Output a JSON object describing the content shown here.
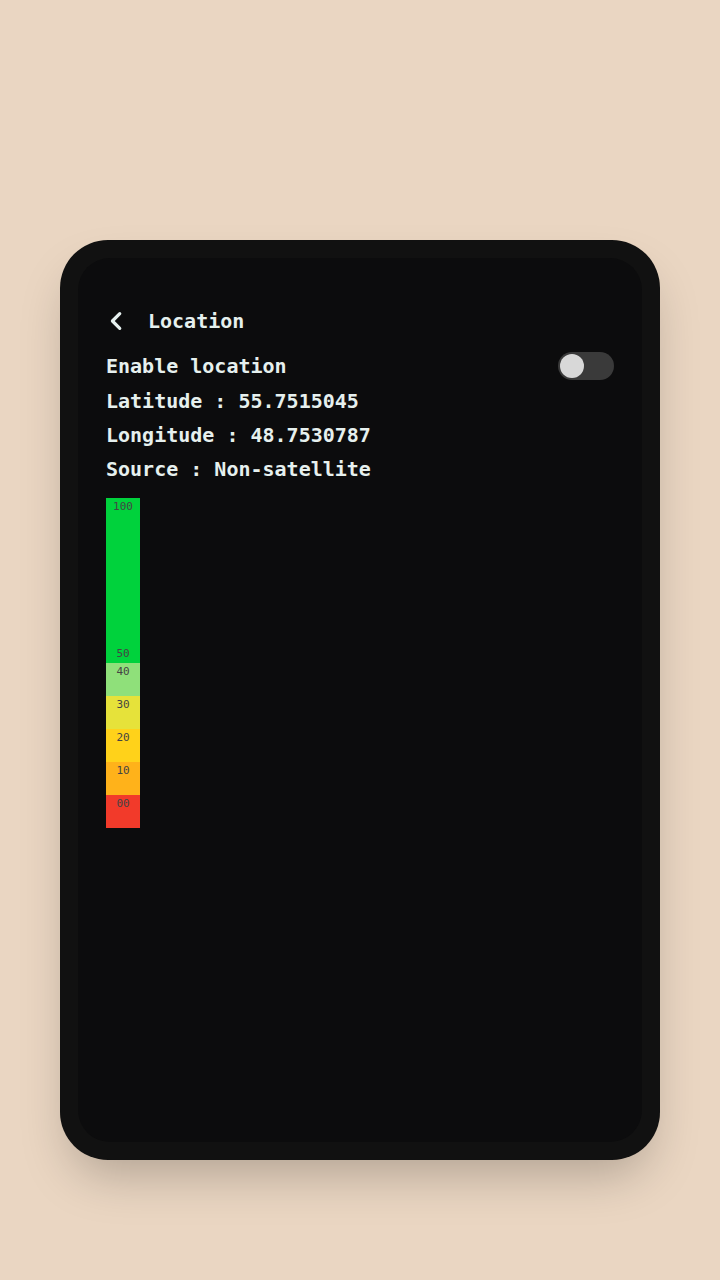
{
  "screen": {
    "title": "Location"
  },
  "toggle": {
    "label": "Enable location",
    "on": false
  },
  "fields": [
    "Latitude : 55.7515045",
    "Longitude : 48.7530787",
    "Source : Non-satellite"
  ],
  "meter": {
    "segments": [
      {
        "labels": [
          "100",
          "50"
        ],
        "color": "#00d23c",
        "from": 50,
        "to": 100
      },
      {
        "labels": [
          "40"
        ],
        "color": "#8fe07a",
        "from": 40,
        "to": 50
      },
      {
        "labels": [
          "30"
        ],
        "color": "#e6e23a",
        "from": 30,
        "to": 40
      },
      {
        "labels": [
          "20"
        ],
        "color": "#ffd21a",
        "from": 20,
        "to": 30
      },
      {
        "labels": [
          "10"
        ],
        "color": "#ffb21a",
        "from": 10,
        "to": 20
      },
      {
        "labels": [
          "00"
        ],
        "color": "#f23a2a",
        "from": 0,
        "to": 10
      }
    ]
  }
}
